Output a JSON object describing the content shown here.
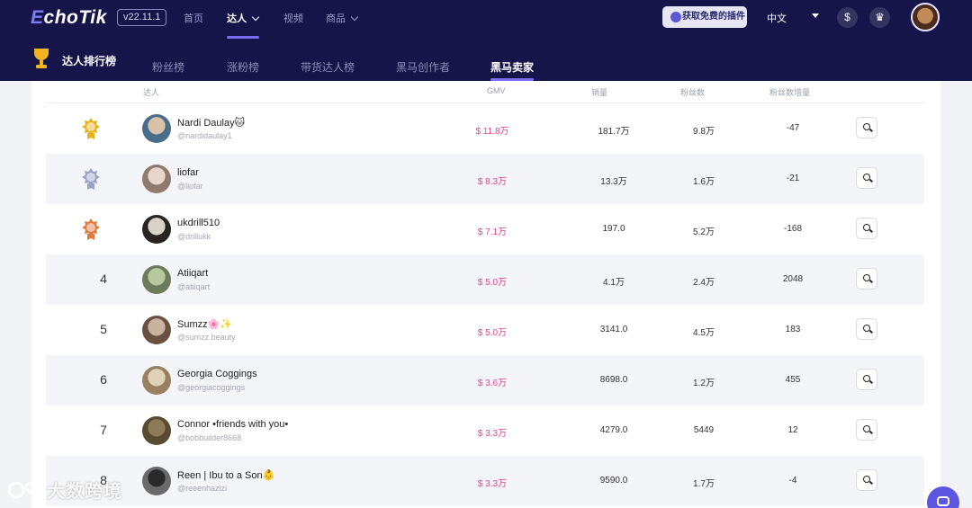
{
  "header": {
    "logo_prefix": "E",
    "logo_text": "choTik",
    "version": "v22.11.1",
    "nav": [
      {
        "label": "首页"
      },
      {
        "label": "达人"
      },
      {
        "label": "视频"
      },
      {
        "label": "商品"
      }
    ],
    "active_nav": "达人",
    "plugin_button": "获取免费的插件",
    "language": "中文"
  },
  "subnav": {
    "title": "达人排行榜",
    "tabs": [
      {
        "label": "粉丝榜"
      },
      {
        "label": "涨粉榜"
      },
      {
        "label": "带货达人榜"
      },
      {
        "label": "黑马创作者"
      },
      {
        "label": "黑马卖家"
      }
    ],
    "active_tab": "黑马卖家"
  },
  "table": {
    "headers": {
      "creator": "达人",
      "gmv": "GMV",
      "sales": "销量",
      "followers": "粉丝数",
      "follower_growth": "粉丝数增量"
    },
    "rows": [
      {
        "rank": "1",
        "medal": "gold",
        "name": "Nardi Daulay🐱",
        "handle": "@nardidaulay1",
        "gmv": "$ 11.8万",
        "sales": "181.7万",
        "followers": "9.8万",
        "growth": "-47"
      },
      {
        "rank": "2",
        "medal": "silver",
        "name": "liofar",
        "handle": "@liofar",
        "gmv": "$ 8.3万",
        "sales": "13.3万",
        "followers": "1.6万",
        "growth": "-21"
      },
      {
        "rank": "3",
        "medal": "bronze",
        "name": "ukdrill510",
        "handle": "@drillukk",
        "gmv": "$ 7.1万",
        "sales": "197.0",
        "followers": "5.2万",
        "growth": "-168"
      },
      {
        "rank": "4",
        "medal": "",
        "name": "Atiiqart",
        "handle": "@atiiqart",
        "gmv": "$ 5.0万",
        "sales": "4.1万",
        "followers": "2.4万",
        "growth": "2048"
      },
      {
        "rank": "5",
        "medal": "",
        "name": "Sumzz🌸✨",
        "handle": "@sumzz.beauty",
        "gmv": "$ 5.0万",
        "sales": "3141.0",
        "followers": "4.5万",
        "growth": "183"
      },
      {
        "rank": "6",
        "medal": "",
        "name": "Georgia Coggings",
        "handle": "@georgiacoggings",
        "gmv": "$ 3.6万",
        "sales": "8698.0",
        "followers": "1.2万",
        "growth": "455"
      },
      {
        "rank": "7",
        "medal": "",
        "name": "Connor •friends with you•",
        "handle": "@bobbuilder8668",
        "gmv": "$ 3.3万",
        "sales": "4279.0",
        "followers": "5449",
        "growth": "12"
      },
      {
        "rank": "8",
        "medal": "",
        "name": "Reen | Ibu to a Son👶",
        "handle": "@reeenhazizi",
        "gmv": "$ 3.3万",
        "sales": "9590.0",
        "followers": "1.7万",
        "growth": "-4"
      }
    ]
  },
  "watermark": "大数跨境",
  "colors": {
    "header_bg": "#16154a",
    "accent": "#7c6cf5",
    "gmv": "#e0458a",
    "gold": "#e8b21c",
    "silver": "#9aa3c7",
    "bronze": "#e07a3a"
  },
  "icons": {
    "gold": "medal-gold-icon",
    "silver": "medal-silver-icon",
    "bronze": "medal-bronze-icon",
    "search": "search-icon",
    "chat": "chat-icon"
  }
}
